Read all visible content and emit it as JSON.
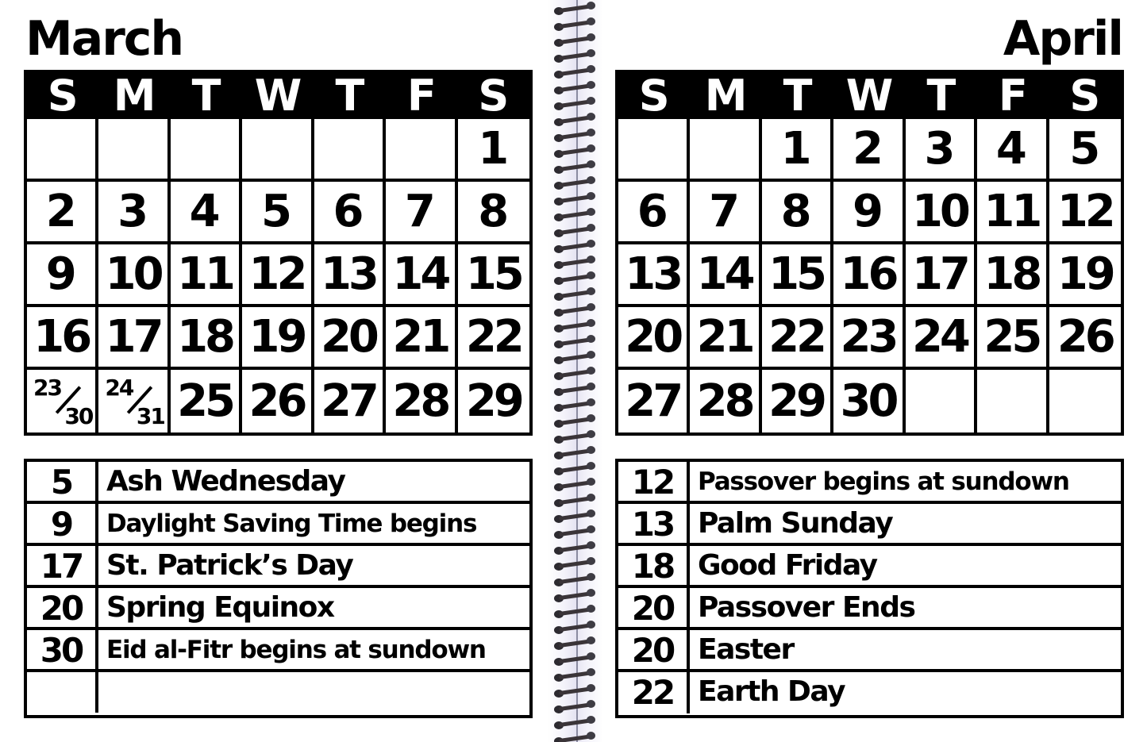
{
  "march": {
    "title": "March",
    "weekdays": [
      "S",
      "M",
      "T",
      "W",
      "T",
      "F",
      "S"
    ],
    "weeks": [
      [
        "",
        "",
        "",
        "",
        "",
        "",
        "1"
      ],
      [
        "2",
        "3",
        "4",
        "5",
        "6",
        "7",
        "8"
      ],
      [
        "9",
        "10",
        "11",
        "12",
        "13",
        "14",
        "15"
      ],
      [
        "16",
        "17",
        "18",
        "19",
        "20",
        "21",
        "22"
      ],
      [
        "23/30",
        "24/31",
        "25",
        "26",
        "27",
        "28",
        "29"
      ]
    ],
    "events": [
      {
        "date": "5",
        "name": "Ash Wednesday"
      },
      {
        "date": "9",
        "name": "Daylight Saving Time begins"
      },
      {
        "date": "17",
        "name": "St. Patrick’s Day"
      },
      {
        "date": "20",
        "name": "Spring Equinox"
      },
      {
        "date": "30",
        "name": "Eid al-Fitr begins at sundown"
      },
      {
        "date": "",
        "name": ""
      }
    ]
  },
  "april": {
    "title": "April",
    "weekdays": [
      "S",
      "M",
      "T",
      "W",
      "T",
      "F",
      "S"
    ],
    "weeks": [
      [
        "",
        "",
        "1",
        "2",
        "3",
        "4",
        "5"
      ],
      [
        "6",
        "7",
        "8",
        "9",
        "10",
        "11",
        "12"
      ],
      [
        "13",
        "14",
        "15",
        "16",
        "17",
        "18",
        "19"
      ],
      [
        "20",
        "21",
        "22",
        "23",
        "24",
        "25",
        "26"
      ],
      [
        "27",
        "28",
        "29",
        "30",
        "",
        "",
        ""
      ]
    ],
    "events": [
      {
        "date": "12",
        "name": "Passover begins at sundown"
      },
      {
        "date": "13",
        "name": "Palm Sunday"
      },
      {
        "date": "18",
        "name": "Good Friday"
      },
      {
        "date": "20",
        "name": "Passover Ends"
      },
      {
        "date": "20",
        "name": "Easter"
      },
      {
        "date": "22",
        "name": "Earth Day"
      }
    ]
  },
  "binding": {
    "icon": "spiral-binding-icon"
  }
}
